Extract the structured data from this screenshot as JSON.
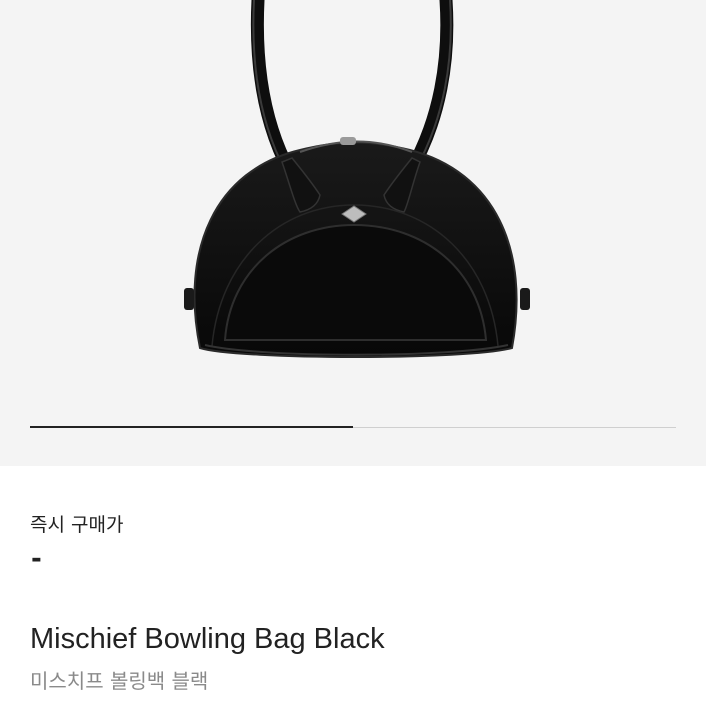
{
  "gallery": {
    "image_alt": "Mischief Bowling Bag Black",
    "pager_progress": 0.5,
    "colors": {
      "background": "#f4f4f4",
      "bag": "#0d0d0d",
      "pager_active": "#222222",
      "pager_track": "#cfcfcf"
    }
  },
  "price": {
    "label": "즉시 구매가",
    "value": "-"
  },
  "product": {
    "name": "Mischief Bowling Bag Black",
    "name_ko": "미스치프 볼링백 블랙"
  }
}
